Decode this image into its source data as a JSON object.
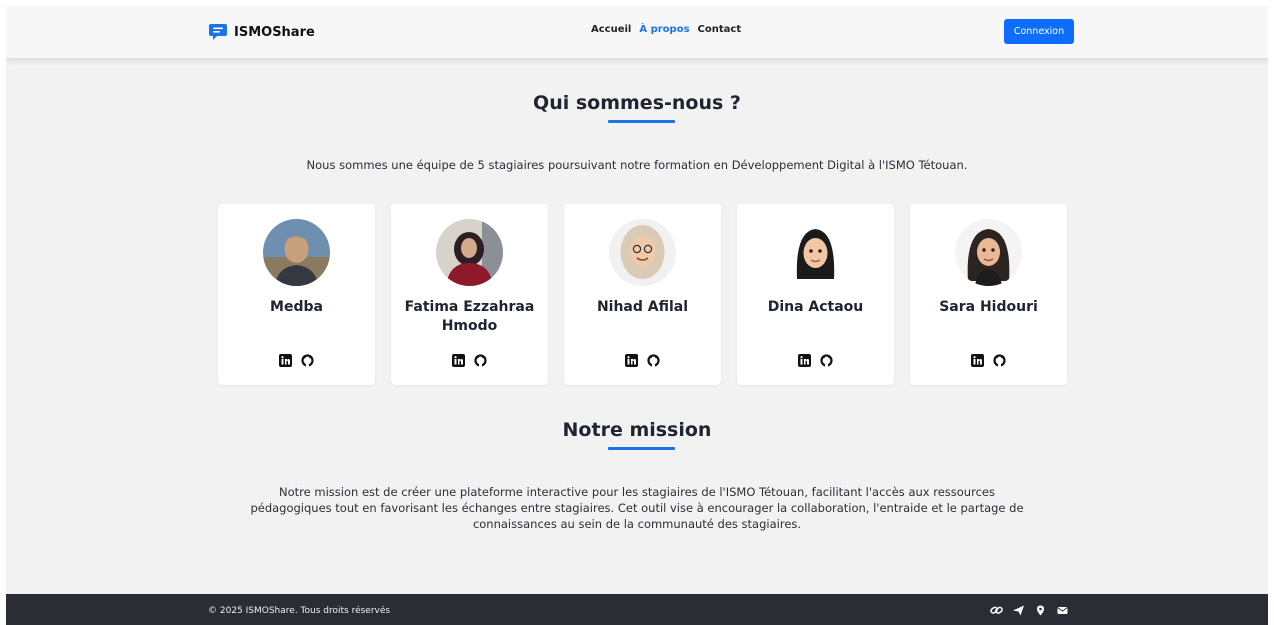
{
  "header": {
    "brand": "ISMOShare",
    "nav": [
      {
        "label": "Accueil"
      },
      {
        "label": "À propos"
      },
      {
        "label": "Contact"
      }
    ],
    "login_label": "Connexion"
  },
  "about": {
    "title": "Qui sommes-nous ?",
    "intro": "Nous sommes une équipe de 5 stagiaires poursuivant notre formation en Développement Digital à l'ISMO Tétouan.",
    "members": [
      {
        "name": "Medba"
      },
      {
        "name": "Fatima Ezzahraa Hmodo"
      },
      {
        "name": "Nihad Afilal"
      },
      {
        "name": "Dina Actaou"
      },
      {
        "name": "Sara Hidouri"
      }
    ]
  },
  "mission": {
    "title": "Notre mission",
    "text": "Notre mission est de créer une plateforme interactive pour les stagiaires de l'ISMO Tétouan, facilitant l'accès aux ressources pédagogiques tout en favorisant les échanges entre stagiaires. Cet outil vise à encourager la collaboration, l'entraide et le partage de connaissances au sein de la communauté des stagiaires."
  },
  "footer": {
    "copyright": "© 2025 ISMOShare. Tous droits réservés",
    "icons": [
      "link-icon",
      "send-icon",
      "location-pin-icon",
      "envelope-icon"
    ]
  },
  "colors": {
    "accent": "#1a73e8",
    "button": "#0d6efd",
    "footer_bg": "#2a2d33"
  }
}
